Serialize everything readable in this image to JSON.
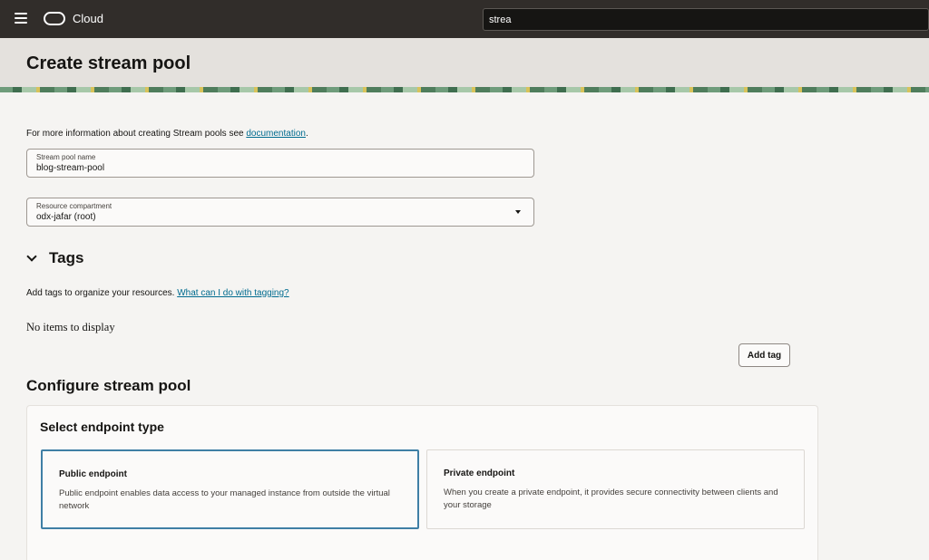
{
  "header": {
    "brand": "Cloud",
    "search_value": "strea"
  },
  "page": {
    "title": "Create stream pool"
  },
  "info": {
    "text": "For more information about creating Stream pools see ",
    "link": "documentation",
    "suffix": "."
  },
  "form": {
    "pool_name": {
      "label": "Stream pool name",
      "value": "blog-stream-pool"
    },
    "compartment": {
      "label": "Resource compartment",
      "value": "odx-jafar (root)"
    }
  },
  "tags": {
    "heading": "Tags",
    "description": "Add tags to organize your resources. ",
    "help_link": "What can I do with tagging?",
    "empty_text": "No items to display",
    "add_button": "Add tag"
  },
  "configure": {
    "heading": "Configure stream pool",
    "endpoint_heading": "Select endpoint type",
    "options": [
      {
        "title": "Public endpoint",
        "description": "Public endpoint enables data access to your managed instance from outside the virtual network",
        "selected": true
      },
      {
        "title": "Private endpoint",
        "description": "When you create a private endpoint, it provides secure connectivity between clients and your storage",
        "selected": false
      }
    ]
  },
  "colors": {
    "header_bg": "#312d2a",
    "link": "#006b8f",
    "selected_border": "#3f7fa5"
  }
}
